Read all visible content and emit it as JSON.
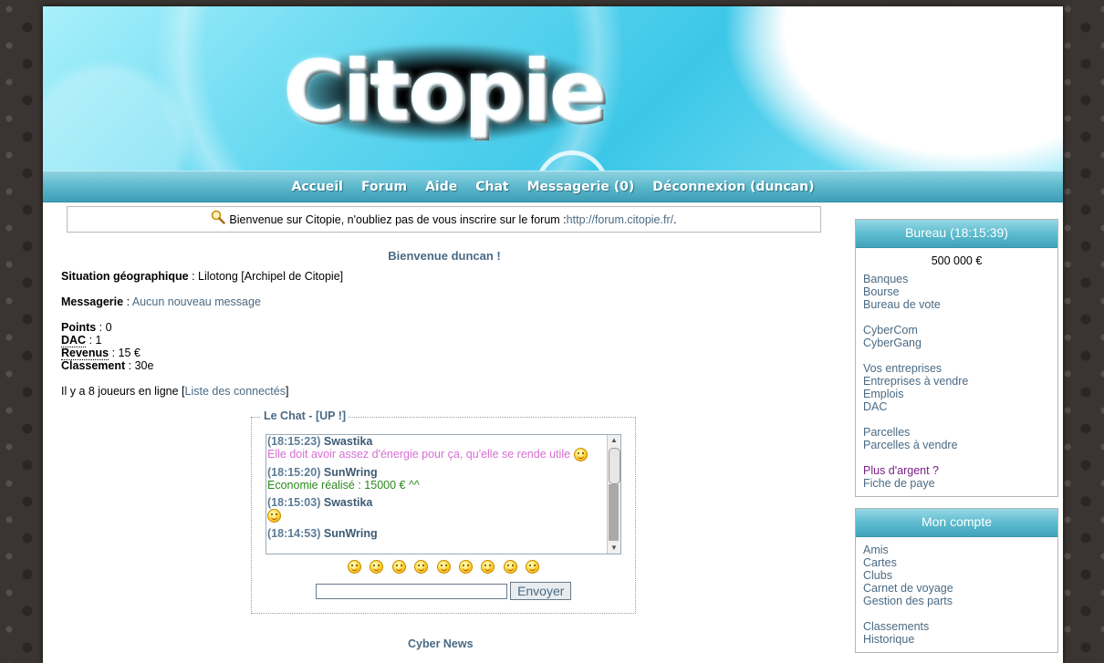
{
  "logo": {
    "text": "Citopie"
  },
  "nav": [
    {
      "label": "Accueil"
    },
    {
      "label": "Forum"
    },
    {
      "label": "Aide"
    },
    {
      "label": "Chat"
    },
    {
      "label": "Messagerie (0)"
    },
    {
      "label": "Déconnexion (duncan)"
    }
  ],
  "info": {
    "icon": "magnifier-icon",
    "text": "Bienvenue sur Citopie, n'oubliez pas de vous inscrire sur le forum : ",
    "link": "http://forum.citopie.fr/",
    "suffix": "."
  },
  "main": {
    "welcome": "Bienvenue duncan !",
    "situation_label": "Situation géographique",
    "situation_value": " : Lilotong [Archipel de Citopie]",
    "messagerie_label": "Messagerie",
    "messagerie_sep": " : ",
    "messagerie_link": "Aucun nouveau message",
    "points_label": "Points",
    "points_value": " : 0",
    "dac_label": "DAC",
    "dac_value": " : 1",
    "revenus_label": "Revenus",
    "revenus_value": " : 15 €",
    "classement_label": "Classement",
    "classement_value": " : 30e",
    "online_text": "Il y a 8 joueurs en ligne [",
    "online_link": "Liste des connectés",
    "online_close": "]",
    "below_chat": "Cyber News"
  },
  "chat": {
    "legend": "Le Chat - [",
    "legend_link": "UP !",
    "legend_close": "]",
    "messages": [
      {
        "time": "(18:15:23)",
        "user": "Swastika",
        "text": "Elle doit avoir assez d'énergie pour ça, qu'elle se rende utile",
        "color": "#d86ed4",
        "smiley": true
      },
      {
        "time": "(18:15:20)",
        "user": "SunWring",
        "text": "Economie réalisé : 15000 € ^^",
        "color": "#2a8a1c",
        "smiley": false
      },
      {
        "time": "(18:15:03)",
        "user": "Swastika",
        "text": "",
        "color": "#000000",
        "smiley": true
      },
      {
        "time": "(18:14:53)",
        "user": "SunWring",
        "text": "",
        "color": "#000000",
        "smiley": false
      }
    ],
    "send_label": "Envoyer",
    "input_value": ""
  },
  "sidebar": {
    "bureau": {
      "title": "Bureau (18:15:39)",
      "amount": "500 000 €",
      "links": [
        "Banques",
        "Bourse",
        "Bureau de vote",
        "",
        "CyberCom",
        "CyberGang",
        "",
        "Vos entreprises",
        "Entreprises à vendre",
        "Emplois",
        "DAC",
        "",
        "Parcelles",
        "Parcelles à vendre",
        "",
        "Plus d'argent ?",
        "Fiche de paye"
      ]
    },
    "compte": {
      "title": "Mon compte",
      "links": [
        "Amis",
        "Cartes",
        "Clubs",
        "Carnet de voyage",
        "Gestion des parts",
        "",
        "Classements",
        "Historique"
      ]
    }
  },
  "colors": {
    "accent": "#4a6a84",
    "nav": "#5cb8cc",
    "purple_link": "#7a1f86"
  }
}
